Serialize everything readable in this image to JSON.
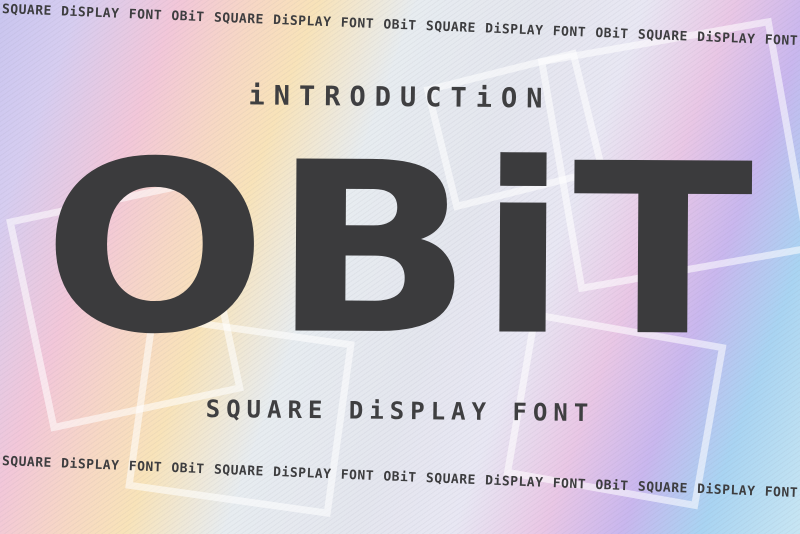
{
  "ribbon_text": "SQUARE DiSPLAY FONT OBiT SQUARE DiSPLAY FONT OBiT SQUARE DiSPLAY FONT OBiT SQUARE DiSPLAY FONT",
  "intro": "iNTRODUCTiON",
  "title": "OBiT",
  "subtitle": "SQUARE DiSPLAY FONT",
  "colors": {
    "text": "#3b3b3d",
    "frame_stroke": "#ffffff"
  }
}
